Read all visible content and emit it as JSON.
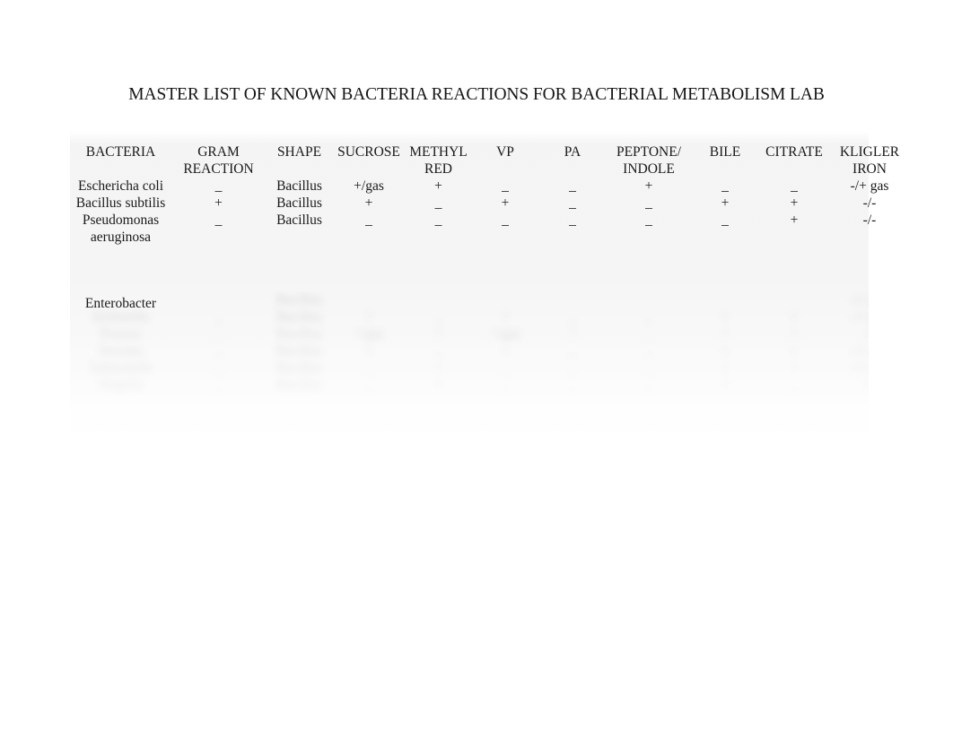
{
  "document": {
    "title": "MASTER LIST OF KNOWN BACTERIA REACTIONS FOR BACTERIAL METABOLISM LAB",
    "background_color": "#ffffff",
    "text_color": "#1a1a1a"
  },
  "table": {
    "columns": [
      {
        "key": "bacteria",
        "label": "BACTERIA"
      },
      {
        "key": "gram",
        "label": "GRAM REACTION"
      },
      {
        "key": "shape",
        "label": "SHAPE"
      },
      {
        "key": "sucrose",
        "label": "SUCROSE"
      },
      {
        "key": "mr",
        "label": "METHYL RED"
      },
      {
        "key": "vp",
        "label": "VP"
      },
      {
        "key": "pa",
        "label": "PA"
      },
      {
        "key": "peptone",
        "label": "PEPTONE/ INDOLE"
      },
      {
        "key": "bile",
        "label": "BILE"
      },
      {
        "key": "citrate",
        "label": "CITRATE"
      },
      {
        "key": "kligler",
        "label": "KLIGLER IRON"
      }
    ],
    "header_lines": {
      "bacteria": [
        "BACTERIA",
        ""
      ],
      "gram": [
        "GRAM",
        "REACTION"
      ],
      "shape": [
        "SHAPE",
        ""
      ],
      "sucrose": [
        "SUCROSE",
        ""
      ],
      "mr": [
        "METHYL",
        "RED"
      ],
      "vp": [
        "VP",
        ""
      ],
      "pa": [
        "PA",
        ""
      ],
      "peptone": [
        "PEPTONE/",
        "INDOLE"
      ],
      "bile": [
        "BILE",
        ""
      ],
      "citrate": [
        "CITRATE",
        ""
      ],
      "kligler": [
        "KLIGLER",
        "IRON"
      ]
    },
    "rows": [
      {
        "bacteria": "Eschericha coli",
        "gram": "_",
        "shape": "Bacillus",
        "sucrose": "+/gas",
        "mr": "+",
        "vp": "_",
        "pa": "_",
        "peptone": "+",
        "bile": "_",
        "citrate": "_",
        "kligler": "-/+ gas"
      },
      {
        "bacteria": "Bacillus subtilis",
        "gram": "+",
        "shape": "Bacillus",
        "sucrose": "+",
        "mr": "_",
        "vp": "+",
        "pa": "_",
        "peptone": "_",
        "bile": "+",
        "citrate": "+",
        "kligler": "-/-"
      },
      {
        "bacteria": "Pseudomonas aeruginosa",
        "gram": "_",
        "shape": "Bacillus",
        "sucrose": "_",
        "mr": "_",
        "vp": "_",
        "pa": "_",
        "peptone": "_",
        "bile": "_",
        "citrate": "+",
        "kligler": "-/-"
      },
      {
        "bacteria": "Enterobacter",
        "gram": "",
        "shape": "",
        "sucrose": "",
        "mr": "",
        "vp": "",
        "pa": "",
        "peptone": "",
        "bile": "",
        "citrate": "",
        "kligler": ""
      }
    ],
    "obscured_rows_note": "Remaining rows below are blurred and illegible in the source image."
  }
}
